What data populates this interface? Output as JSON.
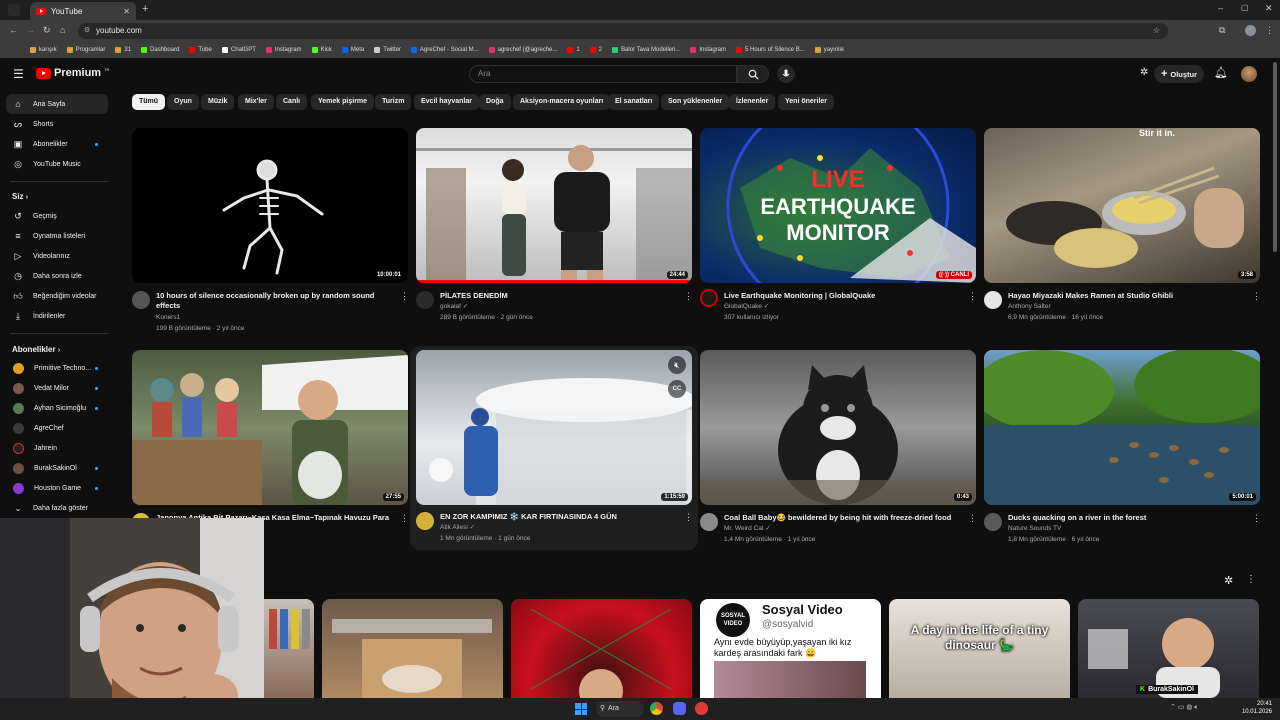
{
  "browser": {
    "tab_title": "YouTube",
    "url": "youtube.com",
    "bookmarks": [
      "karışık",
      "Programlar",
      "31",
      "Dashboard",
      "Tube",
      "ChatGPT",
      "Instagram",
      "Kick",
      "Meta",
      "Twitter",
      "AgreChef - Social M...",
      "agrechef (@agreche...",
      "1",
      "2",
      "Balor Tava Modelleri...",
      "Instagram",
      "5 Hours of Silence B...",
      "yayınlık"
    ]
  },
  "header": {
    "logo": "Premium",
    "logo_sup": "TR",
    "search_placeholder": "Ara",
    "create_label": "Oluştur"
  },
  "sidebar": {
    "main": [
      "Ana Sayfa",
      "Shorts",
      "Abonelikler",
      "YouTube Music"
    ],
    "you_heading": "Siz",
    "you_items": [
      "Geçmiş",
      "Oynatma listeleri",
      "Videolarınız",
      "Daha sonra izle",
      "Beğendiğim videolar",
      "İndirilenler"
    ],
    "subs_heading": "Abonelikler",
    "subs": [
      "Primitive Techno...",
      "Vedat Milor",
      "Ayhan Sicimoğlu",
      "AgreChef",
      "Jahrein",
      "BurakSakinOl",
      "Houston Game"
    ],
    "more_label": "Daha fazla göster"
  },
  "chips": [
    "Tümü",
    "Oyun",
    "Müzik",
    "Mix'ler",
    "Canlı",
    "Yemek pişirme",
    "Turizm",
    "Evcil hayvanlar",
    "Doğa",
    "Aksiyon-macera oyunları",
    "El sanatları",
    "Son yüklenenler",
    "İzlenenler",
    "Yeni öneriler"
  ],
  "videos": [
    {
      "title": "10 hours of silence occasionally broken up by random sound effects",
      "channel": "Koners1",
      "meta": "199 B görüntüleme · 2 yıl önce",
      "duration": "10:00:01"
    },
    {
      "title": "PİLATES DENEDİM",
      "channel": "gokalaf",
      "meta": "289 B görüntüleme · 2 gün önce",
      "duration": "24:44"
    },
    {
      "title": "Live Earthquake Monitoring | GlobalQuake",
      "channel": "GlobalQuake",
      "meta": "307 kullanıcı izliyor",
      "duration": "CANLI",
      "thumb_text": [
        "LIVE",
        "EARTHQUAKE",
        "MONITOR"
      ]
    },
    {
      "title": "Hayao Miyazaki Makes Ramen at Studio Ghibli",
      "channel": "Anthony Salter",
      "meta": "6,9 Mn görüntüleme · 16 yıl önce",
      "duration": "3:58",
      "thumb_text": [
        "Stir it in."
      ]
    },
    {
      "title": "Japonya Antika Bit Pazarı~Kasa Kasa Elma~Tapınak Havuzu Para",
      "channel": "",
      "meta": "",
      "duration": "27:55"
    },
    {
      "title": "EN ZOR KAMPIMIZ ❄️ KAR FIRTINASINDA 4 GÜN",
      "channel": "Atik Ailesi",
      "meta": "1 Mn görüntüleme · 1 gün önce",
      "duration": "1:15:59"
    },
    {
      "title": "Coal Ball Baby😂 bewildered by being hit with freeze-dried food",
      "channel": "Mr. Weird Cat",
      "meta": "1,4 Mn görüntüleme · 1 yıl önce",
      "duration": "0:43"
    },
    {
      "title": "Ducks quacking on a river in the forest",
      "channel": "Nature Sounds TV",
      "meta": "1,8 Mn görüntüleme · 6 yıl önce",
      "duration": "5:00:01"
    }
  ],
  "shorts": {
    "sosyal_title": "Sosyal Video",
    "sosyal_handle": "@sosyalvid",
    "sosyal_text": "Aynı evde büyüyüp,yaşayan iki kız kardeş arasındaki fark 😀",
    "sosyal_logo": "SOSYAL VIDEO",
    "dino_text": "A day in the life of a tiny dinosaur 🦕"
  },
  "stream_overlay": {
    "name": "BurakSakinOl"
  },
  "taskbar": {
    "search": "Ara",
    "time": "20:41",
    "date": "10.01.2026"
  },
  "colors": {
    "bg": "#0f0f0f",
    "accent": "#ff0000",
    "chip": "#272727"
  }
}
